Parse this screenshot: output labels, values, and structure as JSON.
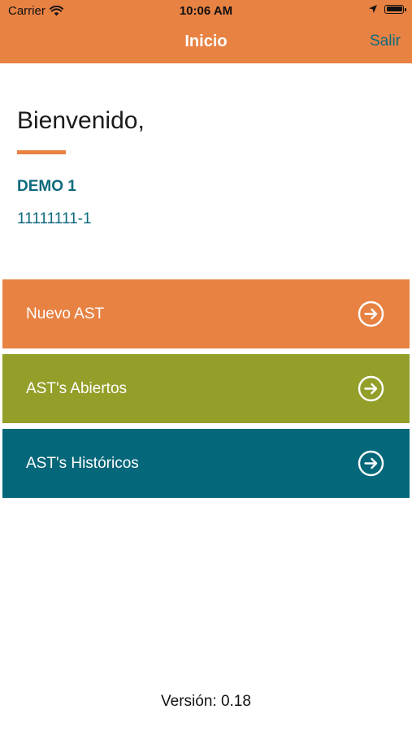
{
  "status_bar": {
    "carrier": "Carrier",
    "time": "10:06 AM"
  },
  "nav": {
    "title": "Inicio",
    "right_button": "Salir"
  },
  "greeting": "Bienvenido,",
  "user": {
    "name": "DEMO 1",
    "id": "11111111-1"
  },
  "menu": [
    {
      "label": "Nuevo AST",
      "color": "#E88243",
      "icon": "arrow-right-circle-icon"
    },
    {
      "label": "AST's Abiertos",
      "color": "#939F29",
      "icon": "arrow-right-circle-icon"
    },
    {
      "label": "AST's Históricos",
      "color": "#05677A",
      "icon": "arrow-right-circle-icon"
    }
  ],
  "footer": {
    "version": "Versión: 0.18"
  },
  "colors": {
    "accent": "#E88243",
    "teal": "#0E6A7D"
  }
}
